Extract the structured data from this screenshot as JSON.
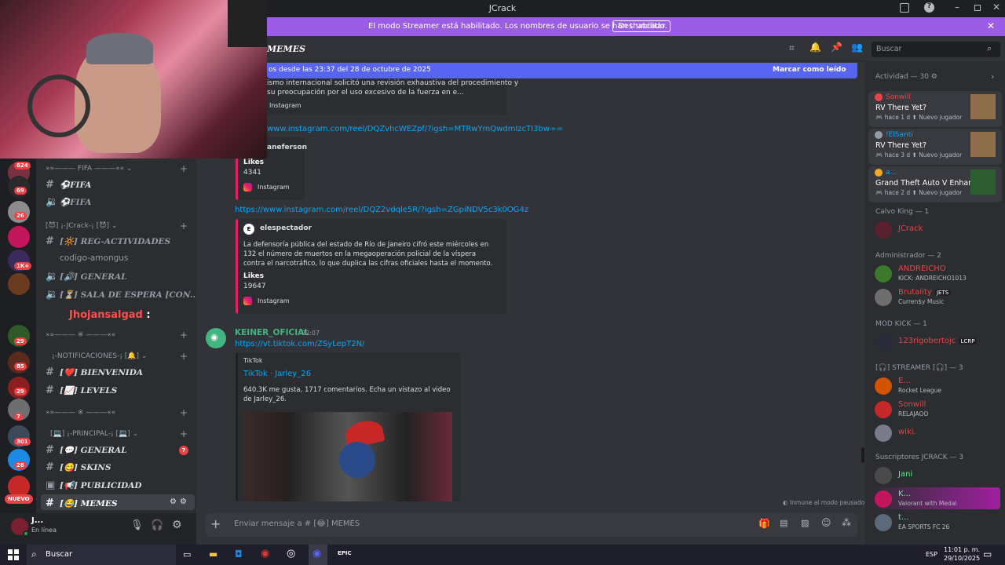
{
  "window": {
    "title": "JCrack"
  },
  "banner": {
    "text": "El modo Streamer está habilitado. Los nombres de usuario se han truncado.",
    "button": "Deshabilitar"
  },
  "header": {
    "channel_name": "MEMES",
    "search_placeholder": "Buscar"
  },
  "newbar": {
    "text": "os desde las 23:37 del 28 de octubre de 2025",
    "mark_read": "Marcar como leído"
  },
  "guilds": {
    "badges": [
      "624",
      "69",
      "26",
      "1K+",
      "29",
      "85",
      "29",
      "7",
      "301",
      "28"
    ],
    "new_label": "NUEVO"
  },
  "channels": {
    "cat_fifa": "»»——— FIFA ———«« ⌄",
    "fifa_text": "⚽FIFA",
    "fifa_voice": "⚽FIFA",
    "cat_jcrack": "[😈] ¡-JCrack-¡ [😈] ⌄",
    "reg": "[🔆] REG-ACTIVIDADES",
    "among": "codigo-amongus",
    "general_voice": "[🔊] GENERAL",
    "espera": "[⏳] SALA DE ESPERA [CON...",
    "overlay_user": "Jhojansalgad",
    "overlay_colon": ":",
    "cat_sep1": "»»——— ※ ———««",
    "cat_notif": "¡-NOTIFICACIONES-¡ [🔔] ⌄",
    "bienvenida": "[❤️] BIENVENIDA",
    "levels": "[📈] LEVELS",
    "cat_sep2": "»»——— ※ ———««",
    "cat_principal": "[💻] ¡-PRINCIPAL-¡ [💻] ⌄",
    "general": "[💬] GENERAL",
    "general_badge": "7",
    "skins": "[😋] SKINS",
    "publicidad": "[📢] PUBLICIDAD",
    "memes": "[😂] MEMES"
  },
  "user": {
    "name": "J...",
    "status": "En línea"
  },
  "messages": {
    "top_text_1": "ismo internacional solicitó una revisión exhaustiva del procedimiento y",
    "top_text_2": "su preocupación por el uso excesivo de la fuerza en e...",
    "top_instagram": "Instagram",
    "link1": "www.instagram.com/reel/DQZvhcWEZpf/?igsh=MTRwYmQwdmIzcTI3bw==",
    "embed1_author": "aneferson",
    "embed1_likes_label": "Likes",
    "embed1_likes": "4341",
    "embed1_source": "Instagram",
    "link2": "https://www.instagram.com/reel/DQZ2vdqle5R/?igsh=ZGpiNDV5c3k0OG4z",
    "embed2_author": "elespectador",
    "embed2_text": "La defensoría pública del estado de Río de Janeiro cifró este miércoles en 132 el número de muertos en la megaoperación policial de la víspera contra el narcotráfico, lo que duplica las cifras oficiales hasta el momento.",
    "embed2_likes_label": "Likes",
    "embed2_likes": "19647",
    "embed2_source": "Instagram",
    "msg_author": "KEINER_OFICIAL",
    "msg_time": "22:07",
    "msg_link": "https://vt.tiktok.com/ZSyLepT2N/",
    "tt_provider": "TikTok",
    "tt_title": "TikTok · Jarley_26",
    "tt_desc": "640.3K me gusta, 1717 comentarios. Echa un vistazo al video de Jarley_26.",
    "immune": "Inmune al modo pausado"
  },
  "composer": {
    "placeholder": "Enviar mensaje a # [😂] MEMES"
  },
  "members": {
    "activity_title": "Actividad — 30",
    "activity": [
      {
        "user": "Sonwill",
        "game": "RV There Yet?",
        "meta": "hace 1 d",
        "tag": "Nuevo jugador"
      },
      {
        "user": "!ElSanti",
        "game": "RV There Yet?",
        "meta": "hace 3 d",
        "tag": "Nuevo jugador"
      },
      {
        "user": "a...",
        "game": "Grand Theft Auto V Enhan...",
        "meta": "hace 2 d",
        "tag": "Nuevo jugador"
      }
    ],
    "groups": [
      {
        "title": "Calvo King — 1",
        "members": [
          {
            "name": "JCrack",
            "status": "",
            "color": "#ed4245"
          }
        ]
      },
      {
        "title": "Administrador — 2",
        "members": [
          {
            "name": "ANDREICHO",
            "status": "KICK: ANDREICHO1013",
            "color": "#ed4245"
          },
          {
            "name": "Brutality",
            "status": "Curren$y Music",
            "color": "#ed4245",
            "tag": "JETS"
          }
        ]
      },
      {
        "title": "MOD KICK — 1",
        "members": [
          {
            "name": "123rigobertojc",
            "status": "",
            "color": "#ed4245",
            "tag": "LCRP"
          }
        ]
      },
      {
        "title": "[🎧] STREAMER [🎧] — 3",
        "members": [
          {
            "name": "E...",
            "status": "Rocket League",
            "color": "#ed4245"
          },
          {
            "name": "Sonwill",
            "status": "RELAJAOO",
            "color": "#ed4245"
          },
          {
            "name": "wiki.",
            "status": "",
            "color": "#ed4245"
          }
        ]
      },
      {
        "title": "Suscriptores JCRACK — 3",
        "members": [
          {
            "name": "Jani",
            "status": "",
            "color": "#57f287"
          },
          {
            "name": "K...",
            "status": "Valorant with Medal",
            "color": "#57f287"
          },
          {
            "name": "t...",
            "status": "EA SPORTS FC 26",
            "color": "#57f287"
          }
        ]
      }
    ]
  },
  "taskbar": {
    "search": "Buscar",
    "lang": "ESP",
    "time": "11:01 p. m.",
    "date": "29/10/2025",
    "epic": "EPIC"
  }
}
